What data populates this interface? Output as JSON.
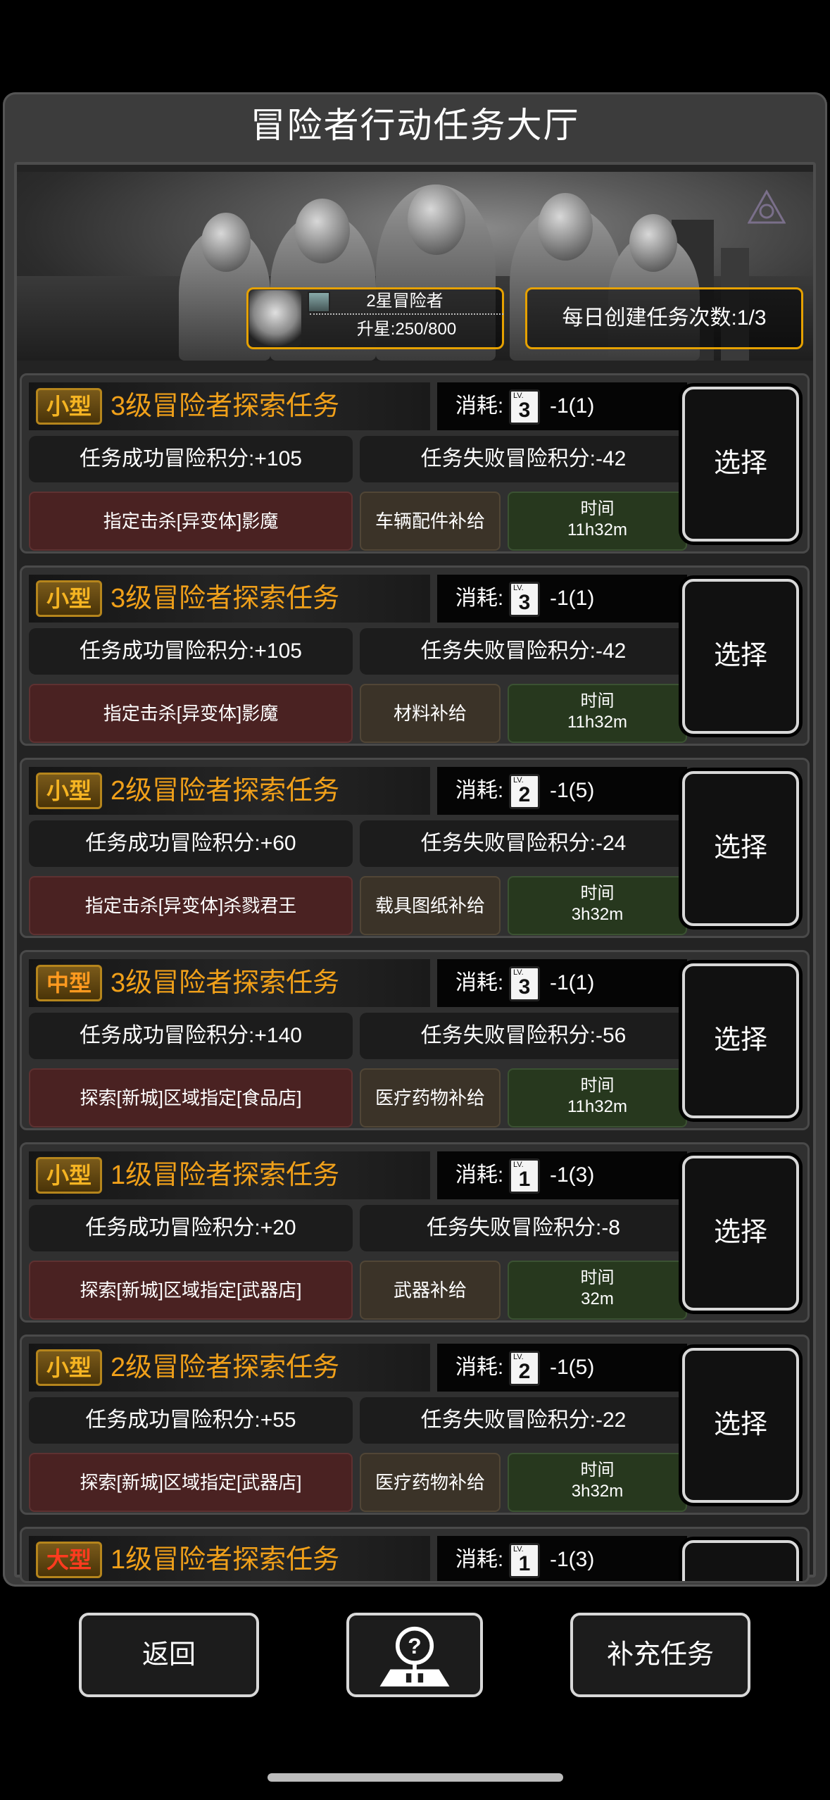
{
  "title": "冒险者行动任务大厅",
  "banner": {
    "rank_name": "2星冒险者",
    "rank_progress": "升星:250/800",
    "daily_count": "每日创建任务次数:1/3"
  },
  "labels": {
    "cost": "消耗:",
    "time": "时间",
    "select": "选择"
  },
  "tasks": [
    {
      "size": "小型",
      "name": "3级冒险者探索任务",
      "lv": "3",
      "cost": "-1(1)",
      "success": "任务成功冒险积分:+105",
      "fail": "任务失败冒险积分:-42",
      "target": "指定击杀[异变体]影魔",
      "reward": "车辆配件补给",
      "time": "11h32m"
    },
    {
      "size": "小型",
      "name": "3级冒险者探索任务",
      "lv": "3",
      "cost": "-1(1)",
      "success": "任务成功冒险积分:+105",
      "fail": "任务失败冒险积分:-42",
      "target": "指定击杀[异变体]影魔",
      "reward": "材料补给",
      "time": "11h32m"
    },
    {
      "size": "小型",
      "name": "2级冒险者探索任务",
      "lv": "2",
      "cost": "-1(5)",
      "success": "任务成功冒险积分:+60",
      "fail": "任务失败冒险积分:-24",
      "target": "指定击杀[异变体]杀戮君王",
      "reward": "载具图纸补给",
      "time": "3h32m"
    },
    {
      "size": "中型",
      "name": "3级冒险者探索任务",
      "lv": "3",
      "cost": "-1(1)",
      "success": "任务成功冒险积分:+140",
      "fail": "任务失败冒险积分:-56",
      "target": "探索[新城]区域指定[食品店]",
      "reward": "医疗药物补给",
      "time": "11h32m"
    },
    {
      "size": "小型",
      "name": "1级冒险者探索任务",
      "lv": "1",
      "cost": "-1(3)",
      "success": "任务成功冒险积分:+20",
      "fail": "任务失败冒险积分:-8",
      "target": "探索[新城]区域指定[武器店]",
      "reward": "武器补给",
      "time": "32m"
    },
    {
      "size": "小型",
      "name": "2级冒险者探索任务",
      "lv": "2",
      "cost": "-1(5)",
      "success": "任务成功冒险积分:+55",
      "fail": "任务失败冒险积分:-22",
      "target": "探索[新城]区域指定[武器店]",
      "reward": "医疗药物补给",
      "time": "3h32m"
    },
    {
      "size": "大型",
      "name": "1级冒险者探索任务",
      "lv": "1",
      "cost": "-1(3)"
    }
  ],
  "buttons": {
    "back": "返回",
    "refill": "补充任务"
  },
  "icons": {
    "help": "help-location-icon",
    "emblem": "triangle-emblem-icon"
  },
  "colors": {
    "accent": "#f0a01a",
    "badge_border": "#e6a100"
  }
}
